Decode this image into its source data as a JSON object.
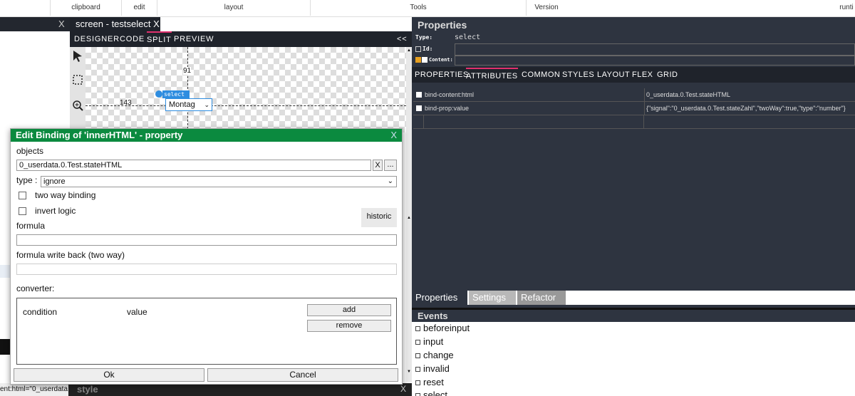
{
  "menu": [
    "clipboard",
    "edit",
    "layout",
    "Tools",
    "Version",
    "runti"
  ],
  "left_strip": {
    "close": "X"
  },
  "screen_tab": {
    "label": "screen - testselect",
    "close": "X"
  },
  "modes": [
    "DESIGNER",
    "CODE",
    "SPLIT",
    "PREVIEW"
  ],
  "collapse": "<<",
  "canvas": {
    "num_top": "91",
    "num_left": "143",
    "widget_tag": "select",
    "widget_value": "Montag"
  },
  "dialog": {
    "title": "Edit Binding of 'innerHTML' - property",
    "close": "X",
    "objects_label": "objects",
    "objects_value": "0_userdata.0.Test.stateHTML",
    "clear": "X",
    "browse": "...",
    "type_label": "type :",
    "type_value": "ignore",
    "two_way": "two way binding",
    "invert": "invert logic",
    "historic": "historic",
    "formula_label": "formula",
    "formula_wb_label": "formula write back (two way)",
    "converter_label": "converter:",
    "condition": "condition",
    "value": "value",
    "add": "add",
    "remove": "remove",
    "ok": "Ok",
    "cancel": "Cancel"
  },
  "bottom_left": {
    "status": "ent:html=\"0_userdata.0.",
    "style": "style"
  },
  "properties": {
    "header": "Properties",
    "type_label": "Type:",
    "type_value": "select",
    "id_label": "Id:",
    "content_label": "Content:",
    "tabs": [
      "PROPERTIES",
      "ATTRIBUTES",
      "COMMON",
      "STYLES",
      "LAYOUT",
      "FLEX",
      "GRID"
    ],
    "rows": [
      {
        "key": "bind-content:html",
        "value": "0_userdata.0.Test.stateHTML"
      },
      {
        "key": "bind-prop:value",
        "value": "{\"signal\":\"0_userdata.0.Test.stateZahl\",\"twoWay\":true,\"type\":\"number\"}"
      }
    ],
    "bottom_tabs": [
      "Properties",
      "Settings",
      "Refactor"
    ]
  },
  "events": {
    "header": "Events",
    "items": [
      "beforeinput",
      "input",
      "change",
      "invalid",
      "reset",
      "select"
    ]
  },
  "colors": {
    "dialog_title": "#0b8a3f",
    "panel": "#2e3440",
    "active_tab": "#e0306e"
  }
}
